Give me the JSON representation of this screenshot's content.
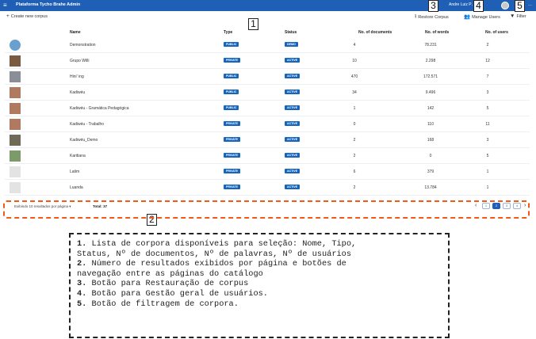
{
  "app": {
    "menu_icon": "hamburger-icon",
    "title": "Plataforma Tycho Brahe Admin",
    "user_name": "Andre Luiz P…",
    "user_extra": "…"
  },
  "toolbar": {
    "create_label": "Create new corpus",
    "restore_label": "Restore Corpus",
    "manage_users_label": "Manage Users",
    "filter_label": "Filter"
  },
  "callouts": {
    "c1": "1",
    "c2": "2",
    "c3": "3",
    "c4": "4",
    "c5": "5"
  },
  "table": {
    "headers": {
      "name": "Name",
      "type": "Type",
      "status": "Status",
      "docs": "No. of documents",
      "words": "No. of words",
      "users": "No. of users"
    },
    "rows": [
      {
        "name": "Demonstration",
        "type": "PUBLIC",
        "status": "DEMO",
        "docs": "4",
        "words": "78.231",
        "users": "2",
        "thumb_color": "#6aa0d0"
      },
      {
        "name": "Grupo Willi",
        "type": "PRIVATE",
        "status": "ACTIVE",
        "docs": "10",
        "words": "2.298",
        "users": "12",
        "thumb_color": "#7a5a40"
      },
      {
        "name": "Hiniʼ ing",
        "type": "PUBLIC",
        "status": "ACTIVE",
        "docs": "470",
        "words": "172.571",
        "users": "7",
        "thumb_color": "#8a8f95"
      },
      {
        "name": "Kadiwéu",
        "type": "PUBLIC",
        "status": "ACTIVE",
        "docs": "34",
        "words": "9.496",
        "users": "3",
        "thumb_color": "#b07a60"
      },
      {
        "name": "Kadiwéu - Gramática Pedagógica",
        "type": "PUBLIC",
        "status": "ACTIVE",
        "docs": "1",
        "words": "142",
        "users": "5",
        "thumb_color": "#b07a60"
      },
      {
        "name": "Kadiwéu - Trabalho",
        "type": "PRIVATE",
        "status": "ACTIVE",
        "docs": "0",
        "words": "110",
        "users": "11",
        "thumb_color": "#b07a60"
      },
      {
        "name": "Kadiwéu_Demo",
        "type": "PRIVATE",
        "status": "ACTIVE",
        "docs": "2",
        "words": "168",
        "users": "3",
        "thumb_color": "#6f6a58"
      },
      {
        "name": "Karitiana",
        "type": "PRIVATE",
        "status": "ACTIVE",
        "docs": "2",
        "words": "0",
        "users": "5",
        "thumb_color": "#7d9a6a"
      },
      {
        "name": "Latim",
        "type": "PRIVATE",
        "status": "ACTIVE",
        "docs": "6",
        "words": "379",
        "users": "1",
        "thumb_color": "#e3e3e3"
      },
      {
        "name": "Luanda",
        "type": "PRIVATE",
        "status": "ACTIVE",
        "docs": "2",
        "words": "13.784",
        "users": "1",
        "thumb_color": "#e3e3e3"
      }
    ]
  },
  "pagination": {
    "per_page_label": "Exibindo 10 resultados por página ▾",
    "total_label": "Total: 37",
    "pages": [
      "1",
      "2",
      "3",
      "4"
    ],
    "active_page": "2",
    "prev_icon": "‹",
    "next_icon": "›"
  },
  "legend": {
    "lines": [
      {
        "num": "1.",
        "text": " Lista de corpora disponíveis para seleção: Nome, Tipo,"
      },
      {
        "num": "",
        "text": "Status, Nº de documentos, Nº de palavras, Nº de usuários"
      },
      {
        "num": "2.",
        "text": "  Número de resultados exibidos por página e botões de"
      },
      {
        "num": "",
        "text": "navegação entre as páginas do catálogo"
      },
      {
        "num": "3.",
        "text": " Botão para Restauração de corpus"
      },
      {
        "num": "4.",
        "text": " Botão para Gestão geral de usuários."
      },
      {
        "num": "5.",
        "text": " Botão de filtragem de corpora."
      }
    ]
  },
  "colors": {
    "topbar": "#1f5fb5",
    "badge": "#1565c0",
    "dash": "#f05a14"
  }
}
